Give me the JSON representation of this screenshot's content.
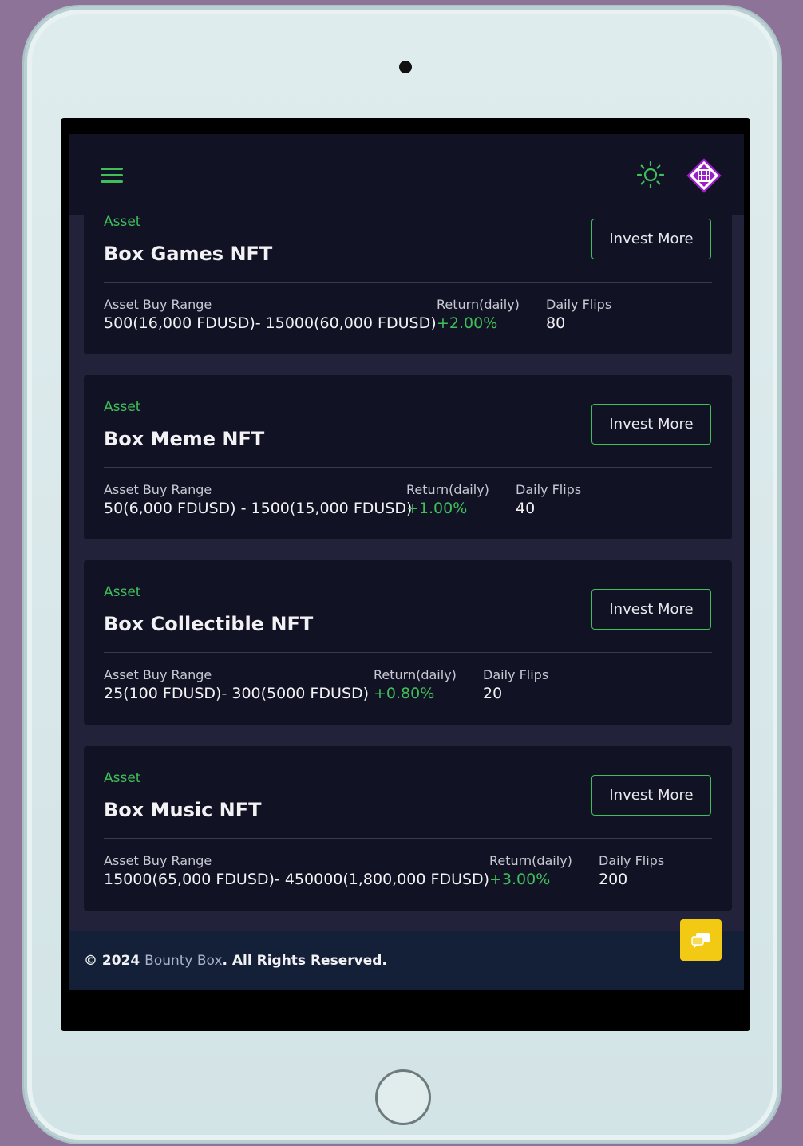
{
  "header": {
    "menu_icon": "hamburger-icon",
    "theme_icon": "sun-icon",
    "logo_icon": "bounty-box-logo"
  },
  "cards": [
    {
      "asset_label": "Asset",
      "title": "Box Games NFT",
      "invest_label": "Invest More",
      "range_label": "Asset Buy Range",
      "range_value": "500(16,000 FDUSD)- 15000(60,000 FDUSD)",
      "return_label": "Return(daily)",
      "return_value": "+2.00%",
      "flips_label": "Daily Flips",
      "flips_value": "80"
    },
    {
      "asset_label": "Asset",
      "title": "Box Meme NFT",
      "invest_label": "Invest More",
      "range_label": "Asset Buy Range",
      "range_value": "50(6,000 FDUSD) - 1500(15,000 FDUSD)",
      "return_label": "Return(daily)",
      "return_value": "+1.00%",
      "flips_label": "Daily Flips",
      "flips_value": "40"
    },
    {
      "asset_label": "Asset",
      "title": "Box Collectible NFT",
      "invest_label": "Invest More",
      "range_label": "Asset Buy Range",
      "range_value": "25(100 FDUSD)- 300(5000 FDUSD)",
      "return_label": "Return(daily)",
      "return_value": "+0.80%",
      "flips_label": "Daily Flips",
      "flips_value": "20"
    },
    {
      "asset_label": "Asset",
      "title": "Box Music NFT",
      "invest_label": "Invest More",
      "range_label": "Asset Buy Range",
      "range_value": "15000(65,000 FDUSD)- 450000(1,800,000 FDUSD)",
      "return_label": "Return(daily)",
      "return_value": "+3.00%",
      "flips_label": "Daily Flips",
      "flips_value": "200"
    }
  ],
  "footer": {
    "copyright": "© 2024",
    "brand": "Bounty Box",
    "rights": ". All Rights Reserved."
  },
  "chat_button": {
    "icon": "chat-icon"
  },
  "colors": {
    "accent_green": "#3fbf5a",
    "card_bg": "#121225",
    "page_bg": "#22223a",
    "footer_bg": "#132038",
    "chat_yellow": "#f2c913",
    "logo_purple": "#9b1fc7"
  }
}
